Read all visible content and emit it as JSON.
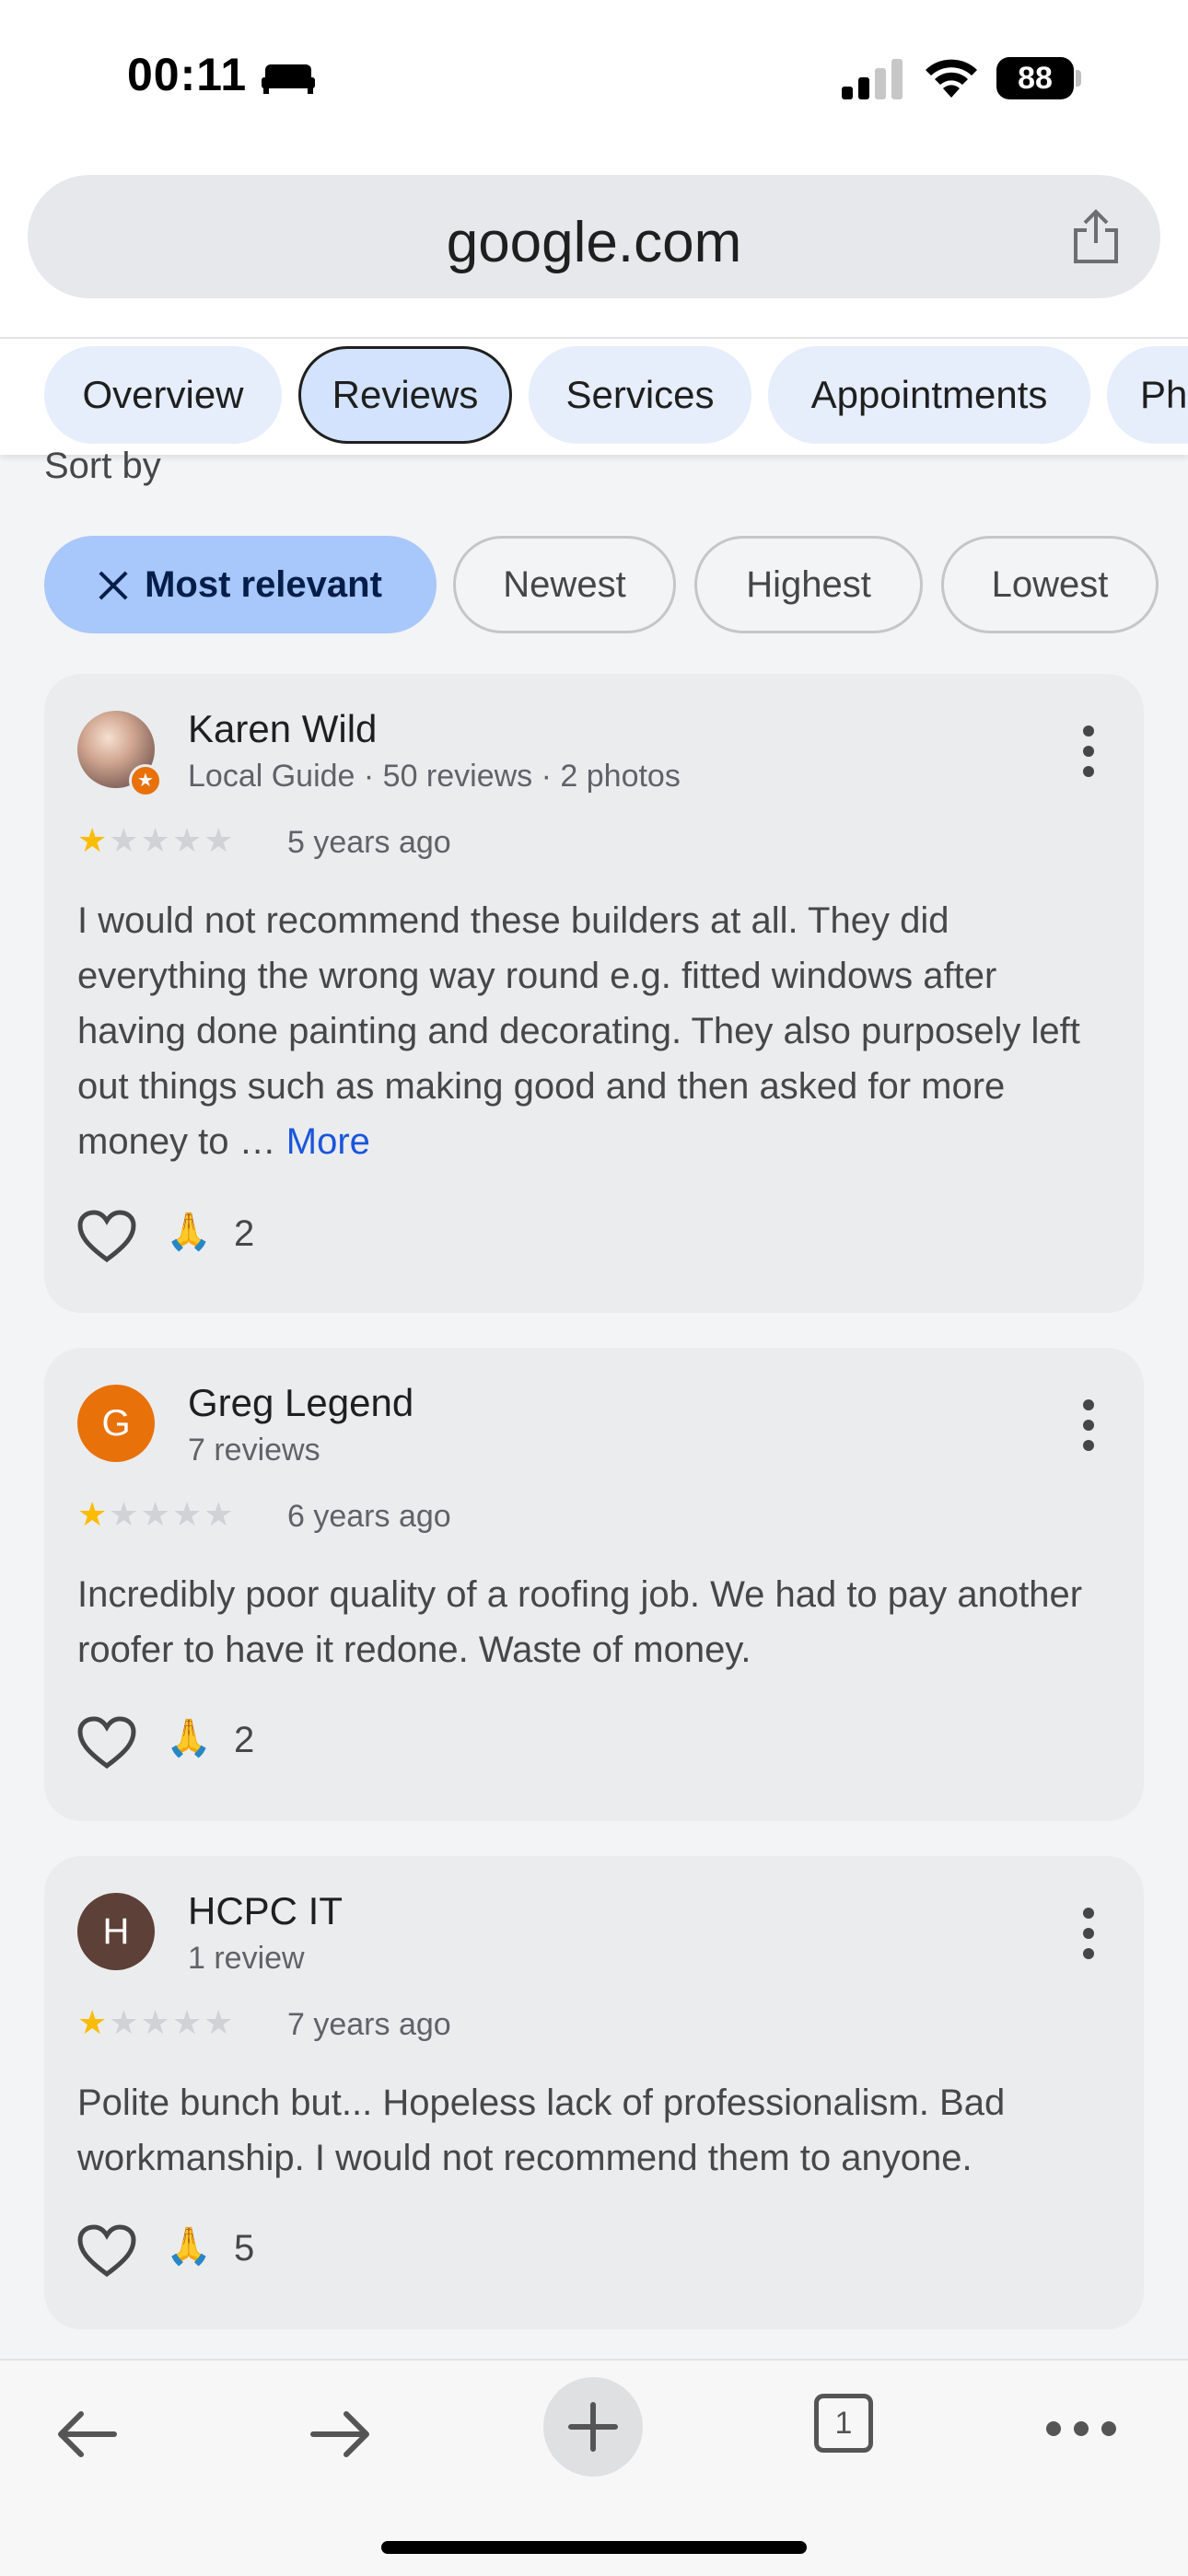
{
  "status": {
    "time": "00:11",
    "battery": "88"
  },
  "browser": {
    "url": "google.com",
    "tab_count": "1"
  },
  "tabs": [
    {
      "label": "Overview"
    },
    {
      "label": "Reviews"
    },
    {
      "label": "Services"
    },
    {
      "label": "Appointments"
    },
    {
      "label": "Ph"
    }
  ],
  "sort": {
    "label": "Sort by",
    "chips": [
      {
        "label": "Most relevant",
        "selected": true
      },
      {
        "label": "Newest"
      },
      {
        "label": "Highest"
      },
      {
        "label": "Lowest"
      }
    ]
  },
  "reviews": [
    {
      "name": "Karen Wild",
      "meta": "Local Guide · 50 reviews · 2 photos",
      "rating": 1,
      "ago": "5 years ago",
      "text": "I would not recommend these builders at all. They did everything the wrong way round e.g. fitted windows after having done painting and decorating. They also purposely left out things such as making good and then asked for more money to … ",
      "more": "More",
      "reaction_emoji": "🙏",
      "reaction_count": "2"
    },
    {
      "name": "Greg Legend",
      "initial": "G",
      "avatar_color": "#e8710a",
      "meta": "7 reviews",
      "rating": 1,
      "ago": "6 years ago",
      "text": "Incredibly poor quality of a roofing job. We had to pay another roofer to have it redone. Waste of money.",
      "reaction_emoji": "🙏",
      "reaction_count": "2"
    },
    {
      "name": "HCPC IT",
      "initial": "H",
      "avatar_color": "#5d4037",
      "meta": "1 review",
      "rating": 1,
      "ago": "7 years ago",
      "text": "Polite bunch but... Hopeless lack of professionalism. Bad workmanship. I would not recommend them to anyone.",
      "reaction_emoji": "🙏",
      "reaction_count": "5"
    }
  ]
}
